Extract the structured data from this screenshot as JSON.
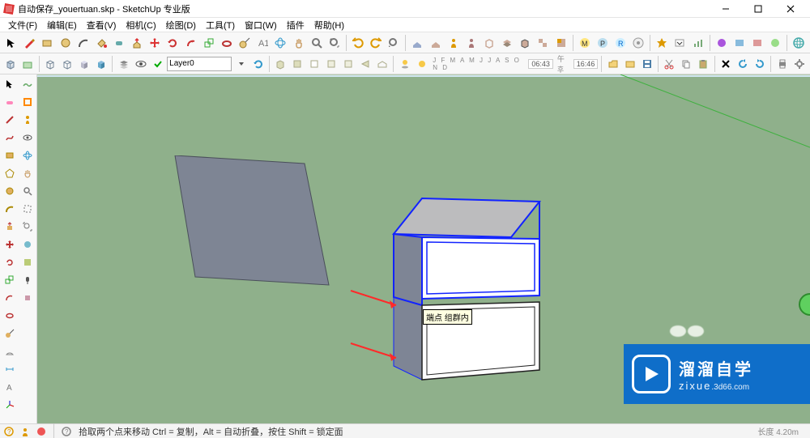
{
  "titlebar": {
    "title": "自动保存_youertuan.skp - SketchUp 专业版"
  },
  "menubar": {
    "items": [
      "文件(F)",
      "编辑(E)",
      "查看(V)",
      "相机(C)",
      "绘图(D)",
      "工具(T)",
      "窗口(W)",
      "插件",
      "帮助(H)"
    ]
  },
  "toolbar2": {
    "layer_label": "Layer0",
    "month_letters": "J  F  M  A  M  J  J  A  S  O  N  D",
    "time": "06:43",
    "ampm": "午후",
    "time2": "16:46"
  },
  "viewport": {
    "tooltip": "端点 组群内"
  },
  "statusbar": {
    "hint": "拾取两个点来移动 Ctrl = 复制，Alt = 自动折叠，按住 Shift = 锁定面",
    "dim_label": "长度",
    "dim_value": "4.20m"
  },
  "watermark": {
    "zh": "溜溜自学",
    "en": "zixue",
    "domain": ".3d66.com"
  },
  "colors": {
    "accent": "#0f6ec9",
    "ground": "#8fb08b",
    "select": "#1223ff"
  }
}
